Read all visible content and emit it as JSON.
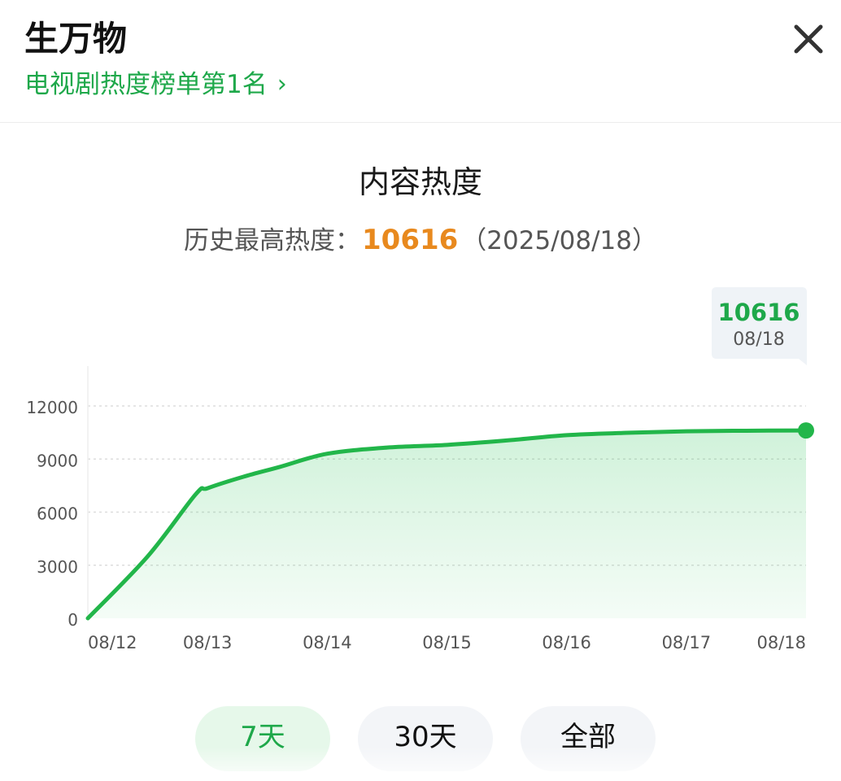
{
  "header": {
    "title": "生万物",
    "rank_link": "电视剧热度榜单第1名",
    "chevron_glyph": "›"
  },
  "summary": {
    "chart_title": "内容热度",
    "peak_label": "历史最高热度：",
    "peak_value": "10616",
    "peak_date": "（2025/08/18）"
  },
  "tooltip": {
    "value": "10616",
    "date": "08/18"
  },
  "tabs": [
    {
      "label": "7天",
      "selected": true
    },
    {
      "label": "30天",
      "selected": false
    },
    {
      "label": "全部",
      "selected": false
    }
  ],
  "colors": {
    "accent": "#1ea84a",
    "line": "#22b64a",
    "peak_value": "#e8891e",
    "selected_tab_bg": "#e6f8ea",
    "tab_bg": "#f3f5f8",
    "grid": "#dddddd",
    "axis_text": "#555555"
  },
  "chart_data": {
    "type": "area",
    "x": [
      "08/12",
      "08/13",
      "08/14",
      "08/15",
      "08/16",
      "08/17",
      "08/18"
    ],
    "y_ticks": [
      0,
      3000,
      6000,
      9000,
      12000
    ],
    "ylim": [
      0,
      12000
    ],
    "grid": true,
    "legend": "none",
    "highlight_index": 6,
    "series": [
      {
        "points": [
          [
            "08/12",
            0
          ],
          [
            "08/12.5",
            3500
          ],
          [
            "08/12.9",
            7000
          ],
          [
            "08/13",
            7350
          ],
          [
            "08/13.3",
            8000
          ],
          [
            "08/13.6",
            8550
          ],
          [
            "08/14",
            9300
          ],
          [
            "08/14.5",
            9650
          ],
          [
            "08/15",
            9800
          ],
          [
            "08/15.5",
            10050
          ],
          [
            "08/16",
            10350
          ],
          [
            "08/16.5",
            10480
          ],
          [
            "08/17",
            10570
          ],
          [
            "08/17.5",
            10600
          ],
          [
            "08/18",
            10616
          ]
        ]
      }
    ]
  }
}
